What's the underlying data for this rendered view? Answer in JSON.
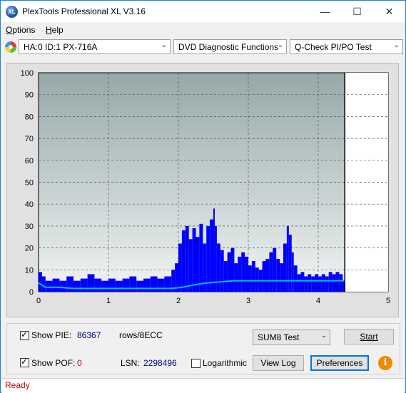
{
  "window": {
    "title": "PlexTools Professional XL V3.16",
    "icon_text": "XL"
  },
  "menu": {
    "options_rest": "ptions",
    "options_key": "O",
    "help_rest": "elp",
    "help_key": "H"
  },
  "toolbar": {
    "drive": "HA:0 ID:1  PX-716A",
    "function": "DVD Diagnostic Functions",
    "test": "Q-Check PI/PO Test"
  },
  "chart_data": {
    "type": "area",
    "xlim": [
      0,
      5
    ],
    "ylim": [
      0,
      100
    ],
    "x_ticks": [
      "0",
      "1",
      "2",
      "3",
      "4",
      "5"
    ],
    "y_ticks": [
      "100",
      "90",
      "80",
      "70",
      "60",
      "50",
      "40",
      "30",
      "20",
      "10",
      "0"
    ],
    "end_marker_x": 4.38,
    "grid": true,
    "series": [
      {
        "kind": "bars",
        "color": "#0000ff",
        "x": [
          0,
          0.05,
          0.1,
          0.2,
          0.3,
          0.4,
          0.5,
          0.6,
          0.7,
          0.8,
          0.9,
          1.0,
          1.1,
          1.2,
          1.3,
          1.4,
          1.5,
          1.6,
          1.7,
          1.8,
          1.9,
          1.95,
          2.0,
          2.05,
          2.1,
          2.15,
          2.2,
          2.25,
          2.3,
          2.35,
          2.4,
          2.45,
          2.5,
          2.52,
          2.55,
          2.6,
          2.65,
          2.7,
          2.75,
          2.8,
          2.85,
          2.9,
          2.95,
          3.0,
          3.05,
          3.1,
          3.15,
          3.2,
          3.25,
          3.3,
          3.35,
          3.4,
          3.45,
          3.5,
          3.55,
          3.58,
          3.62,
          3.65,
          3.7,
          3.75,
          3.8,
          3.85,
          3.9,
          3.95,
          4.0,
          4.05,
          4.1,
          4.15,
          4.2,
          4.25,
          4.3,
          4.35
        ],
        "y": [
          9,
          7,
          5,
          6,
          5,
          7,
          5,
          6,
          8,
          6,
          5,
          6,
          5,
          6,
          7,
          5,
          6,
          7,
          6,
          7,
          10,
          13,
          22,
          28,
          30,
          24,
          29,
          25,
          31,
          22,
          30,
          33,
          38,
          30,
          22,
          19,
          14,
          18,
          20,
          13,
          16,
          18,
          16,
          12,
          14,
          11,
          10,
          14,
          15,
          18,
          20,
          15,
          13,
          22,
          30,
          26,
          18,
          12,
          8,
          9,
          7,
          8,
          7,
          8,
          7,
          8,
          7,
          9,
          8,
          9,
          8,
          5
        ]
      },
      {
        "kind": "line",
        "color": "#00c0ff",
        "x": [
          0,
          0.05,
          0.1,
          0.3,
          0.5,
          1.0,
          1.5,
          1.9,
          2.05,
          2.2,
          2.4,
          2.6,
          2.8,
          3.0,
          3.2,
          3.4,
          3.6,
          3.8,
          4.0,
          4.2,
          4.38
        ],
        "y": [
          4,
          3,
          2,
          2,
          1.5,
          1.5,
          1.5,
          1.5,
          2,
          3,
          4,
          4.5,
          5,
          5,
          5,
          5,
          5,
          5,
          5,
          5,
          5
        ]
      }
    ]
  },
  "controls": {
    "show_pie_label": "Show PIE:",
    "pie_value": "86367",
    "rows_label": "rows/8ECC",
    "show_pof_label": "Show POF:",
    "pof_value": "0",
    "lsn_label": "LSN:",
    "lsn_value": "2298496",
    "log_label": "Logarithmic",
    "sum_select": "SUM8 Test",
    "start": "Start",
    "view_log": "View Log",
    "preferences": "Preferences",
    "info": "i"
  },
  "status": {
    "text": "Ready"
  },
  "colors": {
    "pie_value": "#00008b",
    "pof_value": "#d00000",
    "status": "#c00000",
    "accent": "#0078d7"
  }
}
